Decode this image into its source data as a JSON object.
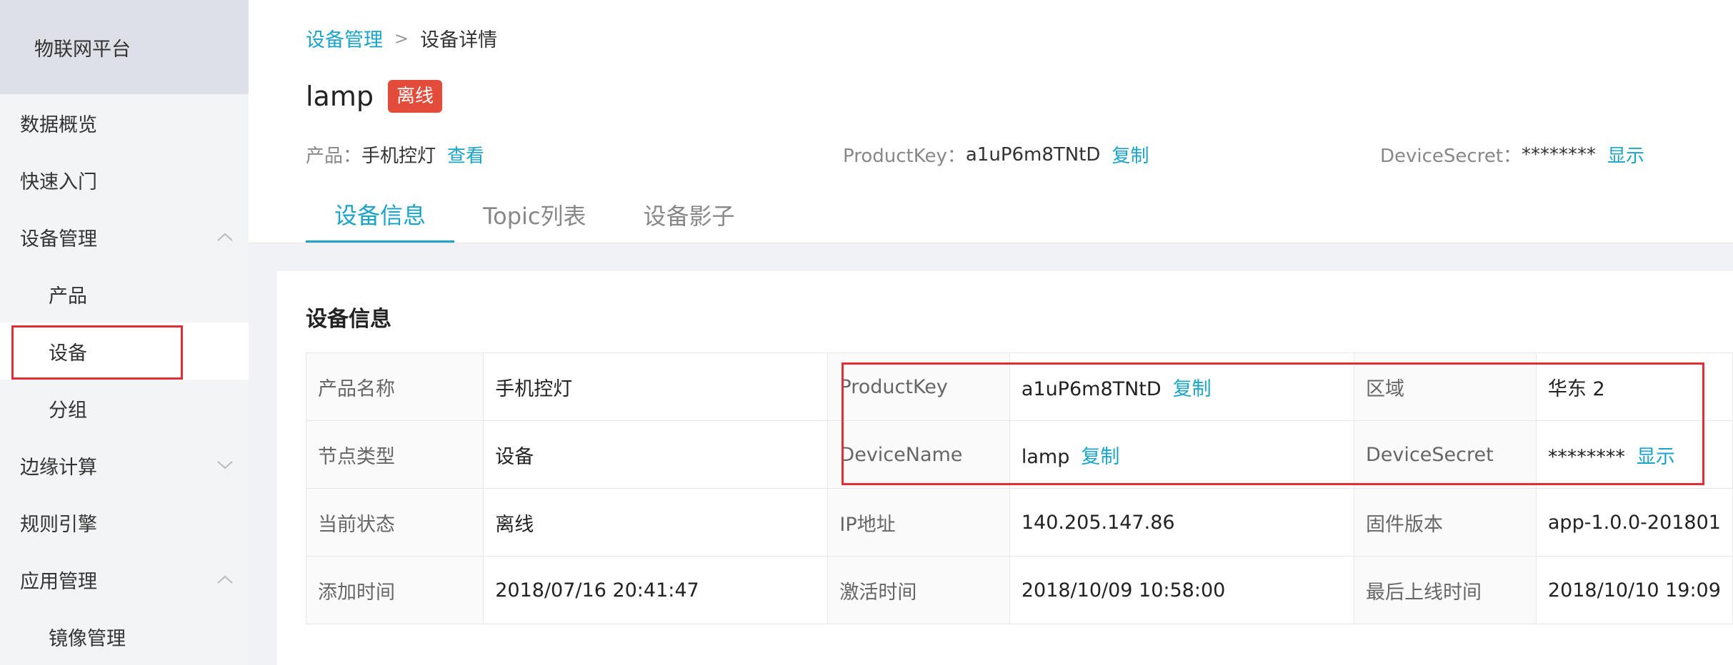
{
  "sidebar": {
    "brand": "物联网平台",
    "items": [
      {
        "label": "数据概览"
      },
      {
        "label": "快速入门"
      },
      {
        "label": "设备管理"
      },
      {
        "label": "产品"
      },
      {
        "label": "设备"
      },
      {
        "label": "分组"
      },
      {
        "label": "边缘计算"
      },
      {
        "label": "规则引擎"
      },
      {
        "label": "应用管理"
      },
      {
        "label": "镜像管理"
      }
    ]
  },
  "breadcrumb": {
    "parent": "设备管理",
    "separator": ">",
    "current": "设备详情"
  },
  "device": {
    "name": "lamp",
    "status_badge": "离线",
    "product_label": "产品：",
    "product_value": "手机控灯",
    "product_link": "查看",
    "productkey_label": "ProductKey：",
    "productkey_value": "a1uP6m8TNtD",
    "productkey_link": "复制",
    "secret_label": "DeviceSecret：",
    "secret_value": "********",
    "secret_link": "显示"
  },
  "tabs": [
    {
      "label": "设备信息"
    },
    {
      "label": "Topic列表"
    },
    {
      "label": "设备影子"
    }
  ],
  "card": {
    "title": "设备信息",
    "rows": [
      [
        {
          "k": "产品名称",
          "v": "手机控灯"
        },
        {
          "k": "ProductKey",
          "v": "a1uP6m8TNtD",
          "link": "复制"
        },
        {
          "k": "区域",
          "v": "华东 2"
        }
      ],
      [
        {
          "k": "节点类型",
          "v": "设备"
        },
        {
          "k": "DeviceName",
          "v": "lamp",
          "link": "复制"
        },
        {
          "k": "DeviceSecret",
          "v": "********",
          "link": "显示"
        }
      ],
      [
        {
          "k": "当前状态",
          "v": "离线"
        },
        {
          "k": "IP地址",
          "v": "140.205.147.86"
        },
        {
          "k": "固件版本",
          "v": "app-1.0.0-201801"
        }
      ],
      [
        {
          "k": "添加时间",
          "v": "2018/07/16 20:41:47"
        },
        {
          "k": "激活时间",
          "v": "2018/10/09 10:58:00"
        },
        {
          "k": "最后上线时间",
          "v": "2018/10/10 19:09"
        }
      ]
    ]
  },
  "colors": {
    "accent": "#1aa4c8",
    "badge": "#e34c3b",
    "highlight": "#e02d36"
  }
}
